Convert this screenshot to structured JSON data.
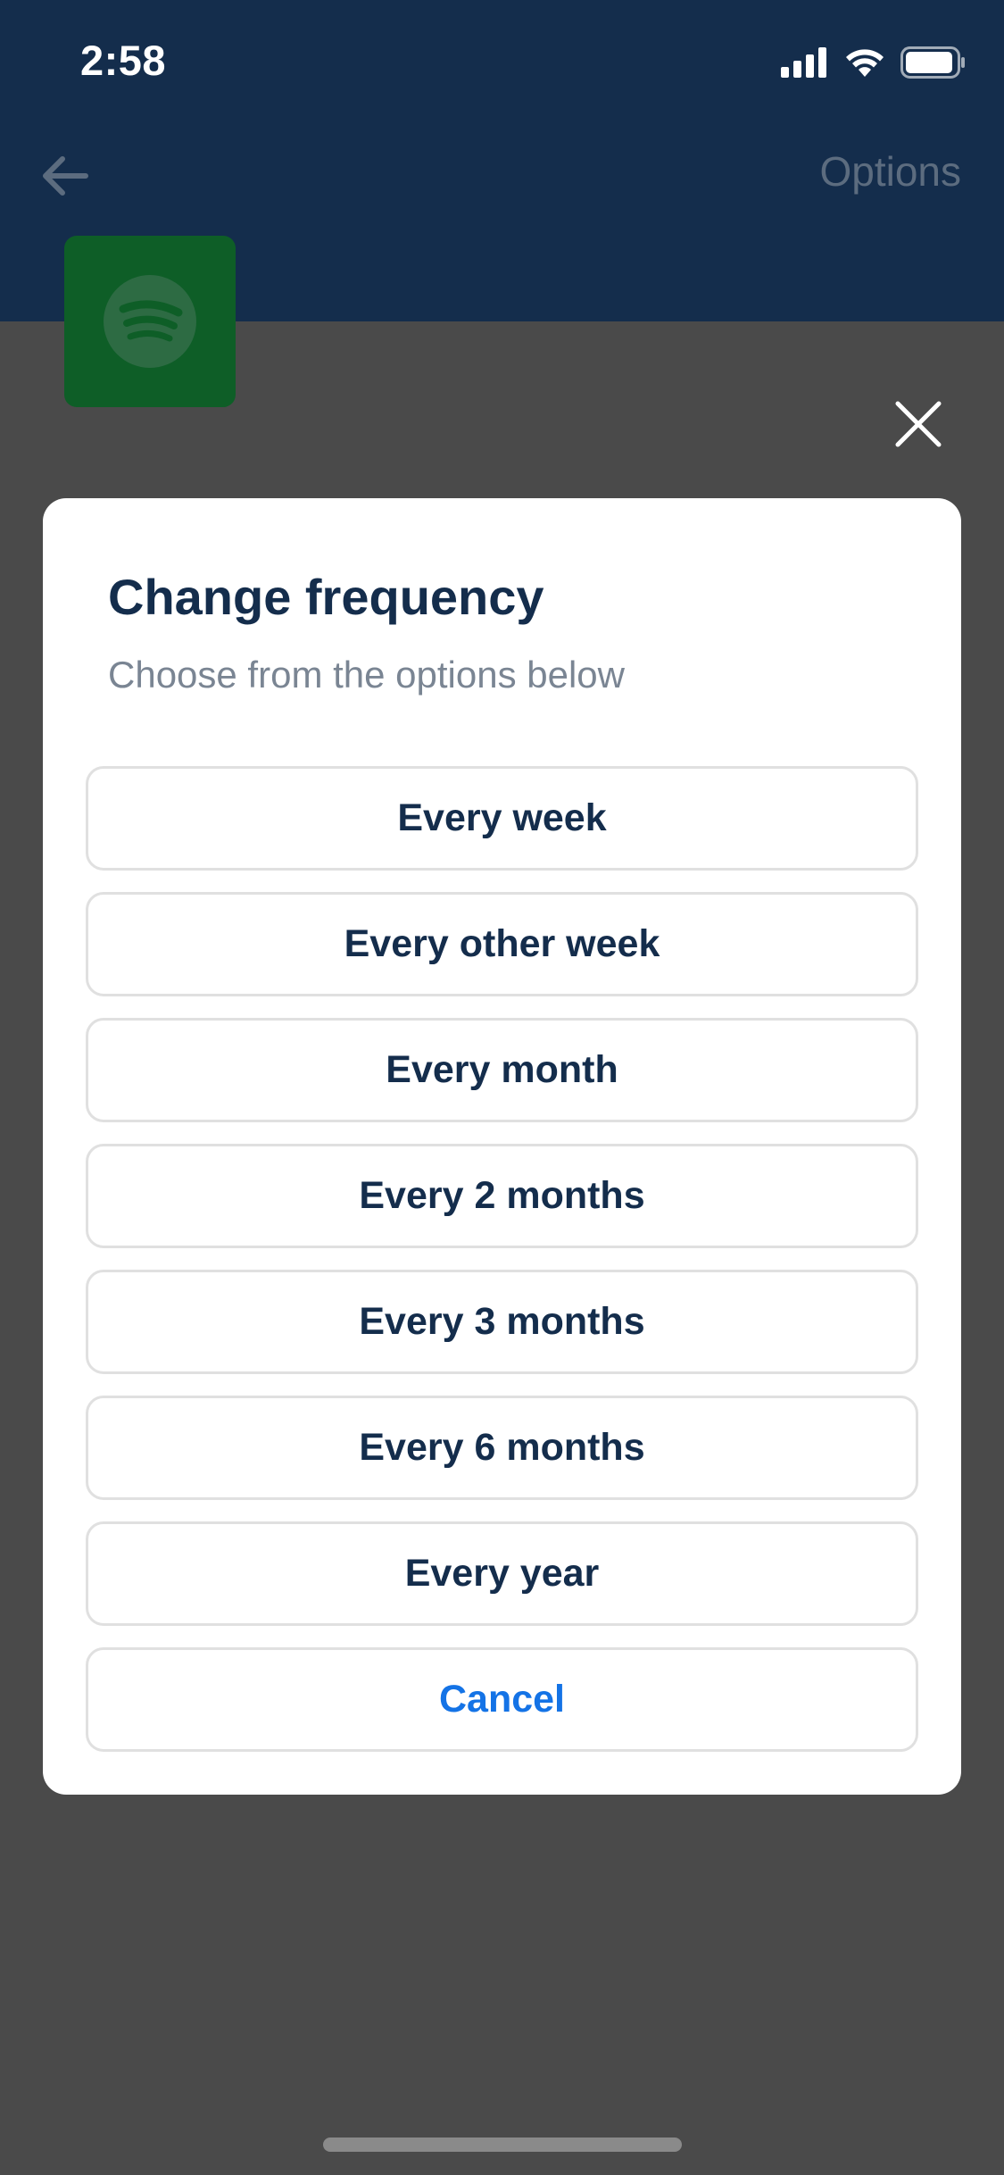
{
  "status_bar": {
    "time": "2:58",
    "icons": [
      "cellular-signal-icon",
      "wifi-icon",
      "battery-icon"
    ]
  },
  "header": {
    "back_icon": "arrow-left-icon",
    "options_label": "Options",
    "logo_icon": "spotify-logo-icon"
  },
  "modal": {
    "close_icon": "close-icon",
    "title": "Change frequency",
    "subtitle": "Choose from the options below",
    "options": [
      "Every week",
      "Every other week",
      "Every month",
      "Every 2 months",
      "Every 3 months",
      "Every 6 months",
      "Every year"
    ],
    "cancel_label": "Cancel"
  },
  "colors": {
    "header_bg": "#142d4c",
    "backdrop": "#4a4a4a",
    "title_text": "#142d4c",
    "subtitle_text": "#7a8593",
    "cancel_text": "#1473e6",
    "logo_bg": "#0e5e27"
  }
}
